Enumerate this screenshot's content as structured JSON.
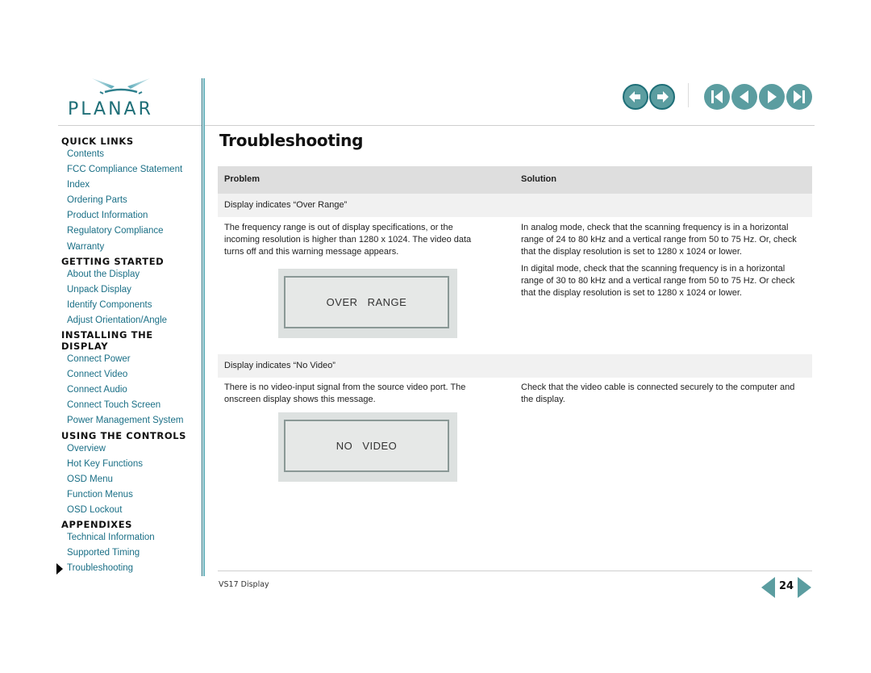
{
  "brand": {
    "name": "PLANAR",
    "accent": "#1f6f78",
    "link_color": "#1a6f86"
  },
  "sidebar": {
    "current_item": "Troubleshooting",
    "sections": [
      {
        "title": "QUICK LINKS",
        "items": [
          "Contents",
          "FCC Compliance Statement",
          "Index",
          "Ordering Parts",
          "Product Information",
          "Regulatory Compliance",
          "Warranty"
        ]
      },
      {
        "title": "GETTING STARTED",
        "items": [
          "About the Display",
          "Unpack Display",
          "Identify Components",
          "Adjust Orientation/Angle"
        ]
      },
      {
        "title": "INSTALLING THE DISPLAY",
        "items": [
          "Connect Power",
          "Connect Video",
          "Connect Audio",
          "Connect Touch Screen",
          "Power Management System"
        ]
      },
      {
        "title": "USING THE CONTROLS",
        "items": [
          "Overview",
          "Hot Key Functions",
          "OSD Menu",
          "Function Menus",
          "OSD Lockout"
        ]
      },
      {
        "title": "APPENDIXES",
        "items": [
          "Technical Information",
          "Supported Timing",
          "Troubleshooting"
        ]
      }
    ]
  },
  "nav_buttons": [
    {
      "name": "back-button",
      "icon": "arrow-left-icon"
    },
    {
      "name": "forward-button",
      "icon": "arrow-right-icon"
    },
    {
      "name": "first-page-button",
      "icon": "skip-first-icon"
    },
    {
      "name": "previous-page-button",
      "icon": "triangle-left-icon"
    },
    {
      "name": "next-page-button",
      "icon": "triangle-right-icon"
    },
    {
      "name": "last-page-button",
      "icon": "skip-last-icon"
    }
  ],
  "main": {
    "title": "Troubleshooting",
    "table": {
      "headers": {
        "problem": "Problem",
        "solution": "Solution"
      },
      "rows": [
        {
          "problem_title": "Display indicates “Over Range”",
          "problem_detail": "The frequency range is out of display specifications, or the incoming resolution is higher than 1280 x 1024. The video data turns off and this warning message appears.",
          "osd_message": "OVER RANGE",
          "solutions": [
            "In analog mode, check that the scanning frequency is in a horizontal range of 24 to 80 kHz and a vertical range from 50 to 75 Hz. Or, check that the display resolution is set to 1280 x 1024 or lower.",
            "In digital mode, check that the scanning frequency is in a horizontal range of 30 to 80 kHz and a vertical range from 50 to 75 Hz. Or check that the display resolution is set to 1280 x 1024 or lower."
          ]
        },
        {
          "problem_title": "Display indicates “No Video”",
          "problem_detail": "There is no video-input signal from the source video port. The onscreen display shows this message.",
          "osd_message": "NO VIDEO",
          "solutions": [
            "Check that the video cable is connected securely to the computer and the display."
          ]
        }
      ]
    }
  },
  "footer": {
    "doc_name": "VS17 Display",
    "page_number": "24"
  }
}
